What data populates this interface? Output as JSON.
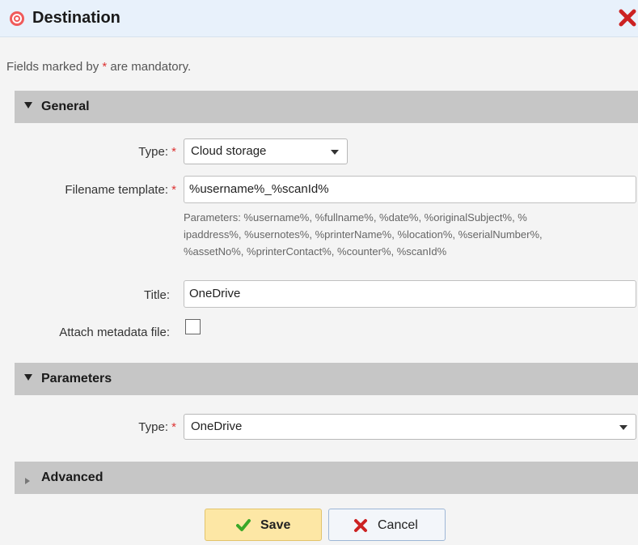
{
  "dialog": {
    "title": "Destination",
    "mandatory_note_prefix": "Fields marked by",
    "mandatory_star": "*",
    "mandatory_note_suffix": "are mandatory."
  },
  "sections": {
    "general": {
      "label": "General",
      "expanded": true
    },
    "parameters": {
      "label": "Parameters",
      "expanded": true
    },
    "advanced": {
      "label": "Advanced",
      "expanded": false
    }
  },
  "general": {
    "type_label": "Type:",
    "type_value": "Cloud storage",
    "filename_label": "Filename template:",
    "filename_value": "%username%_%scanId%",
    "parameters_hint_line1": "Parameters: %username%, %fullname%, %date%, %originalSubject%, %",
    "parameters_hint_line2": "ipaddress%, %usernotes%, %printerName%, %location%, %serialNumber%,",
    "parameters_hint_line3": "%assetNo%, %printerContact%, %counter%, %scanId%",
    "title_label": "Title:",
    "title_value": "OneDrive",
    "attach_label": "Attach metadata file:",
    "attach_checked": false
  },
  "parameters": {
    "type_label": "Type:",
    "type_value": "OneDrive"
  },
  "buttons": {
    "save": "Save",
    "cancel": "Cancel"
  },
  "colors": {
    "required_star": "#dd3333",
    "section_header": "#c6c6c6",
    "save_bg": "#fde7a5",
    "close_red": "#cc2222"
  },
  "icons": {
    "title": "target-icon",
    "close": "close-icon",
    "save": "checkmark-icon",
    "cancel": "x-icon"
  }
}
